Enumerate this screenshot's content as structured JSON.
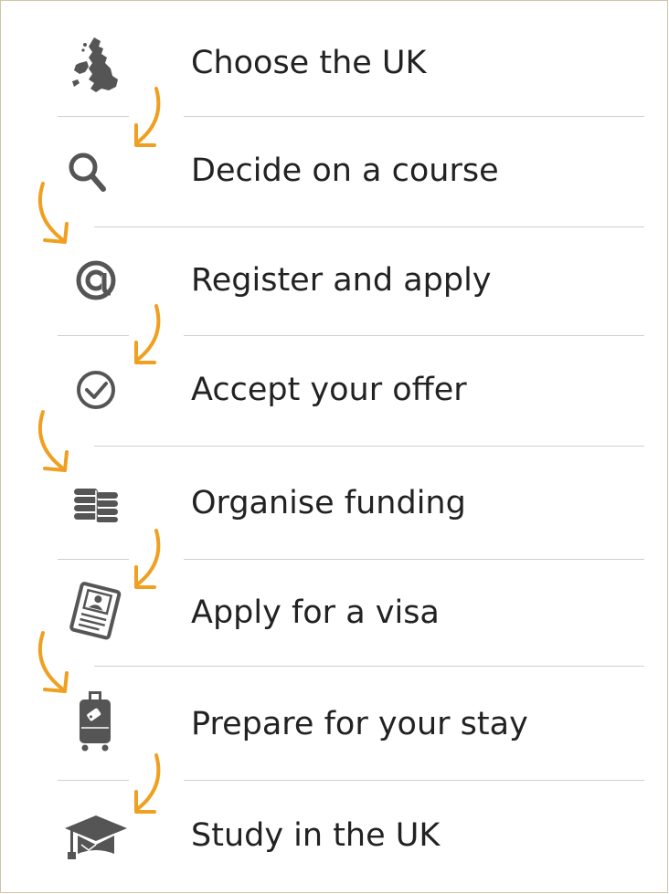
{
  "steps": [
    {
      "label": "Choose the UK",
      "icon": "uk-map-icon"
    },
    {
      "label": "Decide on a course",
      "icon": "magnifier-icon"
    },
    {
      "label": "Register and apply",
      "icon": "at-sign-icon"
    },
    {
      "label": "Accept your offer",
      "icon": "check-circle-icon"
    },
    {
      "label": "Organise funding",
      "icon": "coin-stacks-icon"
    },
    {
      "label": "Apply for a visa",
      "icon": "visa-document-icon"
    },
    {
      "label": "Prepare for your stay",
      "icon": "suitcase-icon"
    },
    {
      "label": "Study in the UK",
      "icon": "graduation-cap-icon"
    }
  ],
  "colors": {
    "arrow": "#f0a020",
    "icon": "#555555",
    "text": "#222222",
    "divider": "#cfcfcf",
    "frame": "#cfc5a8"
  }
}
